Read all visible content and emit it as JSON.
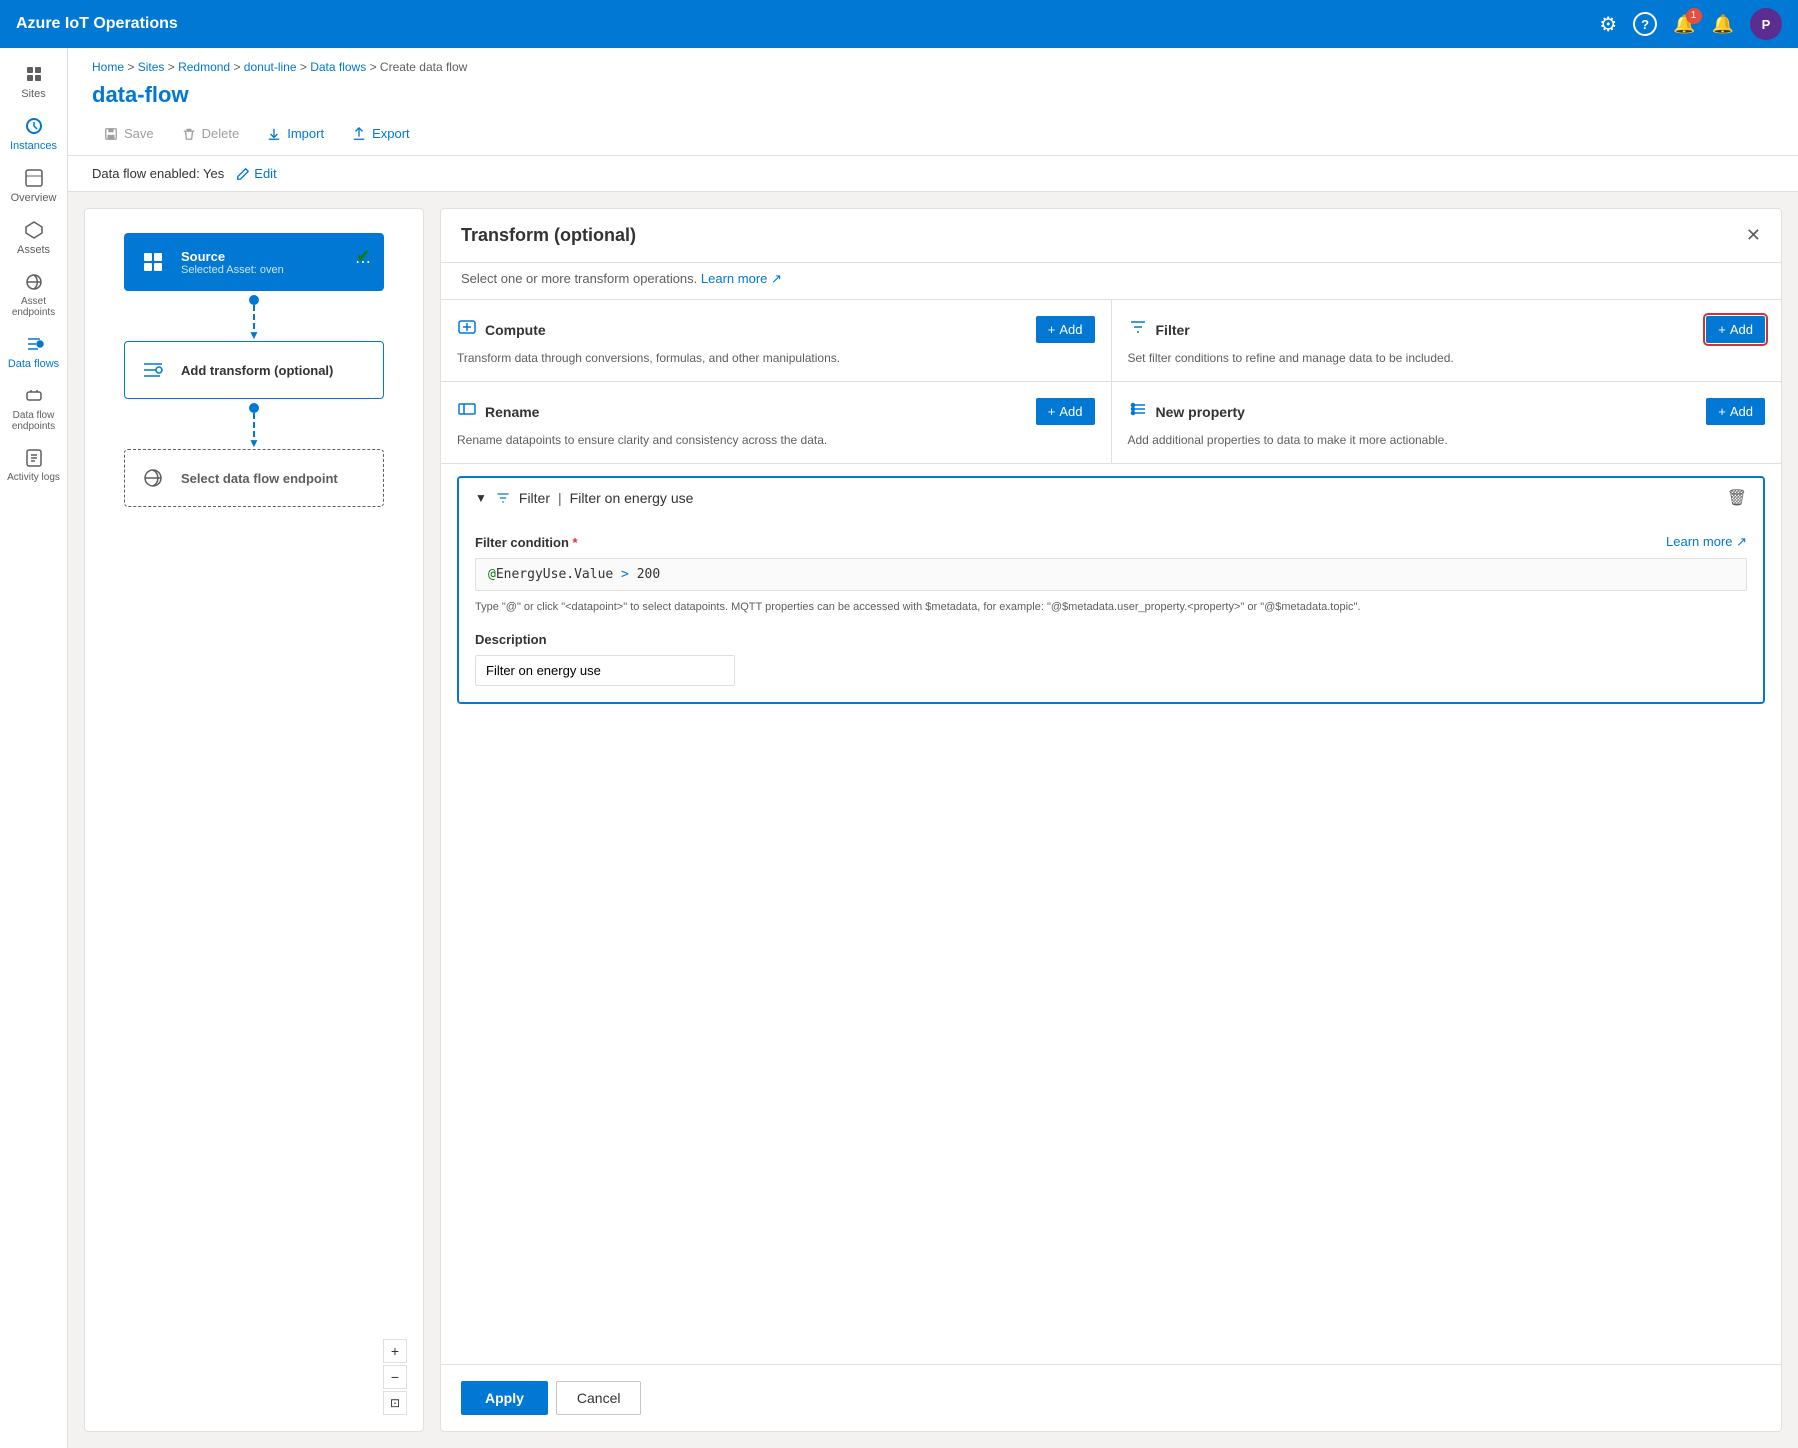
{
  "app": {
    "title": "Azure IoT Operations"
  },
  "nav_icons": {
    "settings": "⚙",
    "help": "?",
    "notification_count": "1",
    "bell": "🔔",
    "avatar_label": "P"
  },
  "sidebar": {
    "items": [
      {
        "id": "sites",
        "label": "Sites",
        "icon": "grid"
      },
      {
        "id": "instances",
        "label": "Instances",
        "icon": "instances"
      },
      {
        "id": "overview",
        "label": "Overview",
        "icon": "overview"
      },
      {
        "id": "assets",
        "label": "Assets",
        "icon": "assets"
      },
      {
        "id": "asset-endpoints",
        "label": "Asset endpoints",
        "icon": "endpoints"
      },
      {
        "id": "data-flows",
        "label": "Data flows",
        "icon": "dataflows",
        "active": true
      },
      {
        "id": "data-flow-endpoints",
        "label": "Data flow endpoints",
        "icon": "dfendpoints"
      },
      {
        "id": "activity-logs",
        "label": "Activity logs",
        "icon": "logs"
      }
    ]
  },
  "breadcrumb": {
    "items": [
      "Home",
      "Sites",
      "Redmond",
      "donut-line",
      "Data flows",
      "Create data flow"
    ]
  },
  "page_title": "data-flow",
  "toolbar": {
    "save_label": "Save",
    "delete_label": "Delete",
    "import_label": "Import",
    "export_label": "Export"
  },
  "flow_status": {
    "label": "Data flow enabled: Yes",
    "edit_label": "Edit"
  },
  "flow_nodes": {
    "source": {
      "title": "Source",
      "subtitle": "Selected Asset: oven",
      "status": "✔"
    },
    "transform": {
      "title": "Add transform (optional)"
    },
    "endpoint": {
      "title": "Select data flow endpoint"
    }
  },
  "canvas_controls": {
    "zoom_in": "+",
    "zoom_out": "−",
    "fit": "⊡"
  },
  "transform_panel": {
    "title": "Transform (optional)",
    "subtitle": "Select one or more transform operations.",
    "learn_more": "Learn more",
    "close_label": "✕",
    "options": [
      {
        "id": "compute",
        "title": "Compute",
        "desc": "Transform data through conversions, formulas, and other manipulations.",
        "add_label": "+ Add"
      },
      {
        "id": "filter",
        "title": "Filter",
        "desc": "Set filter conditions to refine and manage data to be included.",
        "add_label": "+ Add",
        "highlighted": true
      },
      {
        "id": "rename",
        "title": "Rename",
        "desc": "Rename datapoints to ensure clarity and consistency across the data.",
        "add_label": "+ Add"
      },
      {
        "id": "new-property",
        "title": "New property",
        "desc": "Add additional properties to data to make it more actionable.",
        "add_label": "+ Add"
      }
    ]
  },
  "filter_section": {
    "collapse_icon": "▼",
    "title": "Filter",
    "separator": "|",
    "name": "Filter on energy use",
    "condition_label": "Filter condition",
    "required": "*",
    "learn_more": "Learn more",
    "condition_value": "@EnergyUse.Value > 200",
    "hint": "Type \"@\" or click \"<datapoint>\" to select datapoints. MQTT properties can be accessed with $metadata, for example: \"@$metadata.user_property.<property>\" or \"@$metadata.topic\".",
    "description_label": "Description",
    "description_value": "Filter on energy use"
  },
  "footer": {
    "apply_label": "Apply",
    "cancel_label": "Cancel"
  }
}
